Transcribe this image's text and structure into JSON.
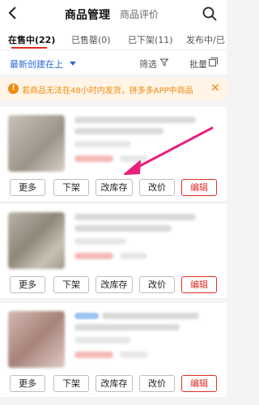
{
  "header": {
    "title": "商品管理",
    "secondary_title": "商品评价"
  },
  "tabs": [
    {
      "label": "在售中(22)",
      "active": true
    },
    {
      "label": "已售罄(0)",
      "active": false
    },
    {
      "label": "已下架(11)",
      "active": false
    },
    {
      "label": "发布中/已",
      "active": false
    }
  ],
  "toolbar": {
    "sort_label": "最新创建在上",
    "filter_label": "筛选",
    "batch_label": "批量"
  },
  "notice": {
    "text": "若商品无法在48小时内发货，拼多多APP中商品"
  },
  "products": [
    {
      "actions": {
        "more": "更多",
        "delist": "下架",
        "stock": "改库存",
        "price": "改价",
        "edit": "编辑"
      }
    },
    {
      "actions": {
        "more": "更多",
        "delist": "下架",
        "stock": "改库存",
        "price": "改价",
        "edit": "编辑"
      }
    },
    {
      "actions": {
        "more": "更多",
        "delist": "下架",
        "stock": "改库存",
        "price": "改价",
        "edit": "编辑"
      }
    }
  ],
  "colors": {
    "accent": "#e02e24",
    "link": "#2a6bd8",
    "warning": "#f08a12",
    "arrow": "#e8207a"
  }
}
